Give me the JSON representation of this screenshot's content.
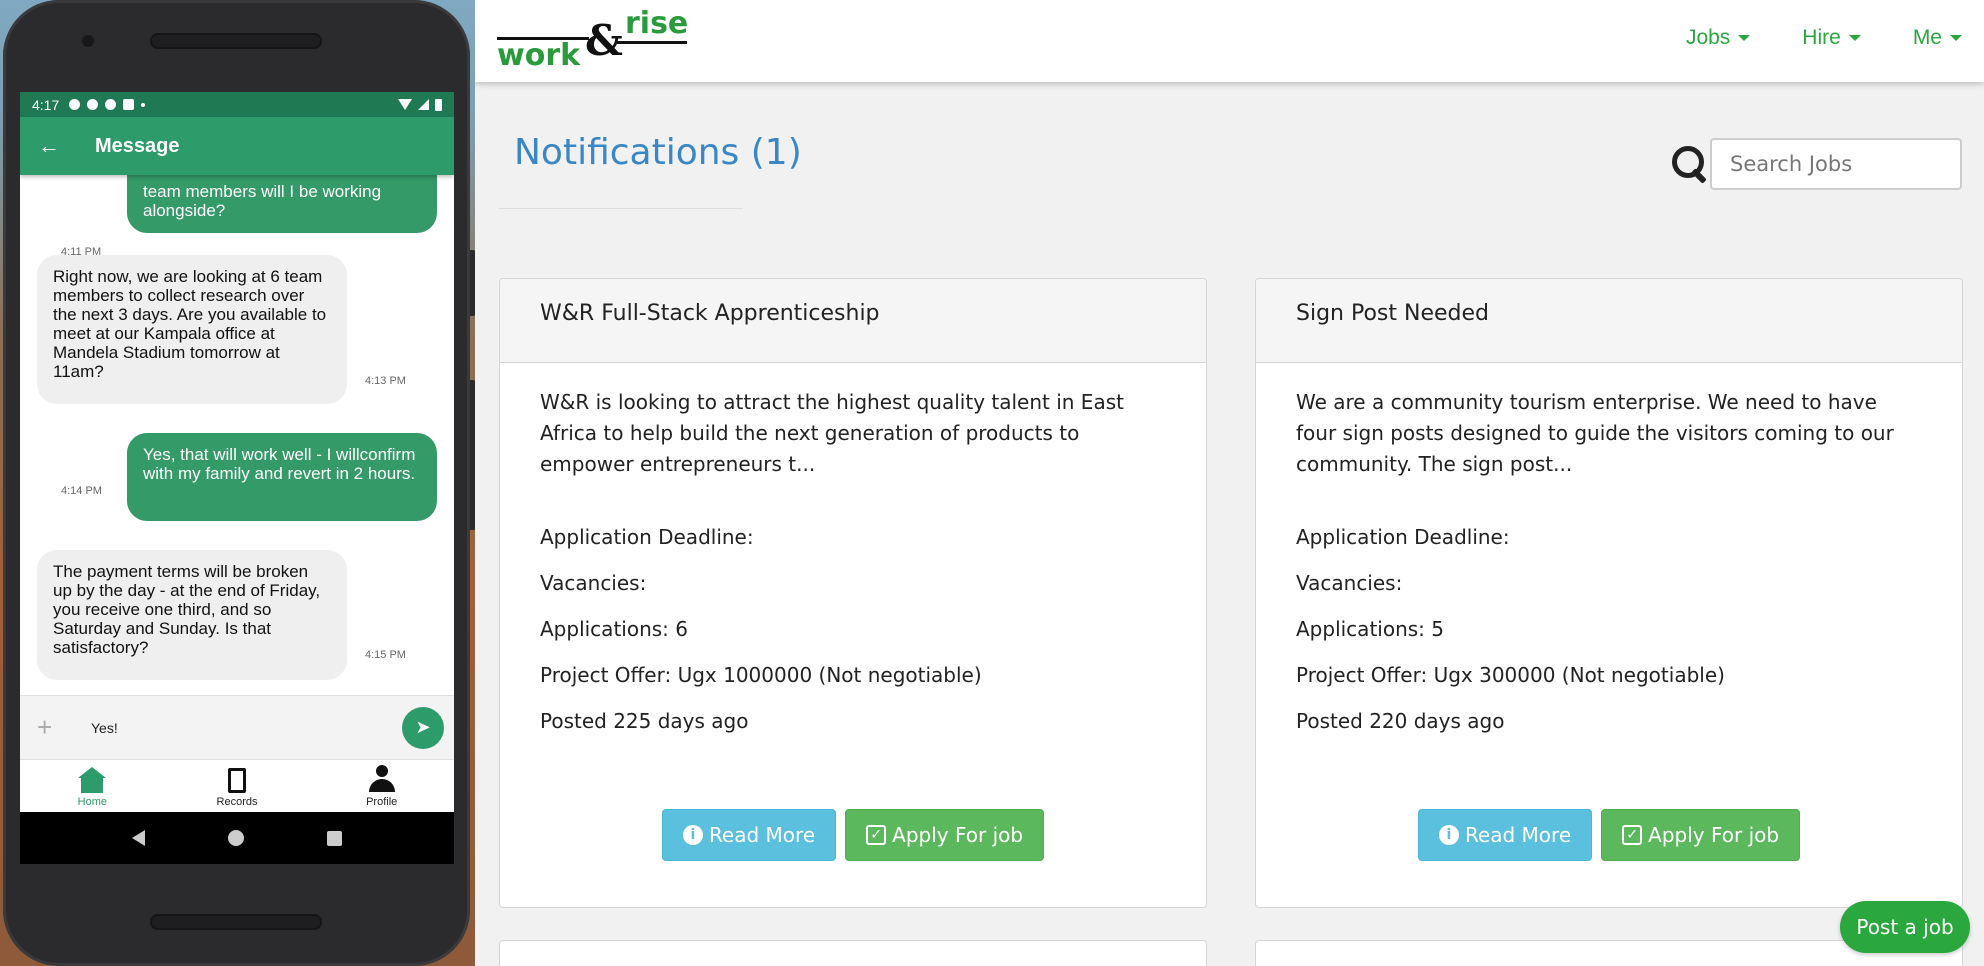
{
  "phone": {
    "status_bar": {
      "time": "4:17"
    },
    "app_bar": {
      "title": "Message",
      "back_icon": "arrow-left-icon"
    },
    "messages": [
      {
        "direction": "out",
        "text": "team members will I be working alongside?",
        "time": "4:11 PM"
      },
      {
        "direction": "in",
        "text": "Right now, we are looking at 6 team members to collect research over the next 3 days. Are you available to meet at our Kampala office at Mandela Stadium tomorrow at 11am?",
        "time": "4:13 PM"
      },
      {
        "direction": "out",
        "text": "Yes, that will work well - I willconfirm with my family and revert in 2 hours.",
        "time": "4:14 PM"
      },
      {
        "direction": "in",
        "text": "The payment terms will be broken up by the day - at the end of Friday, you receive one third, and so Saturday and Sunday. Is that satisfactory?",
        "time": "4:15 PM"
      }
    ],
    "composer": {
      "value": "Yes!",
      "send_icon": "send-icon",
      "add_icon": "plus-icon"
    },
    "bottom_nav": [
      {
        "label": "Home",
        "icon": "home-icon",
        "active": true
      },
      {
        "label": "Records",
        "icon": "records-icon",
        "active": false
      },
      {
        "label": "Profile",
        "icon": "profile-icon",
        "active": false
      }
    ],
    "colors": {
      "primary": "#2d9b6a",
      "status_bar": "#1f7a54",
      "bubble_in": "#efefef"
    }
  },
  "web": {
    "logo": {
      "word1": "work",
      "amp": "&",
      "word2": "rise"
    },
    "nav": [
      {
        "label": "Jobs"
      },
      {
        "label": "Hire"
      },
      {
        "label": "Me"
      }
    ],
    "page_title": "Notifications (1)",
    "search": {
      "placeholder": "Search Jobs"
    },
    "jobs": [
      {
        "title": "W&R Full-Stack Apprenticeship",
        "description": "W&R is looking to attract the highest quality talent in East Africa to help build the next generation of products to empower entrepreneurs t...",
        "deadline": "Application Deadline:",
        "vacancies": "Vacancies:",
        "applications": "Applications: 6",
        "offer": "Project Offer: Ugx 1000000 (Not negotiable)",
        "posted": "Posted 225 days ago",
        "read_more": "Read More",
        "apply": "Apply For job"
      },
      {
        "title": "Sign Post Needed",
        "description": "We are a community tourism enterprise. We need to have four sign posts designed to guide the visitors coming to our community. The sign post...",
        "deadline": "Application Deadline:",
        "vacancies": "Vacancies:",
        "applications": "Applications: 5",
        "offer": "Project Offer: Ugx 300000 (Not negotiable)",
        "posted": "Posted 220 days ago",
        "read_more": "Read More",
        "apply": "Apply For job"
      }
    ],
    "post_job": "Post a job",
    "colors": {
      "brand_green": "#2aa83e",
      "title_blue": "#3a87c5",
      "info": "#5bc0de",
      "success": "#5cb85c"
    }
  }
}
